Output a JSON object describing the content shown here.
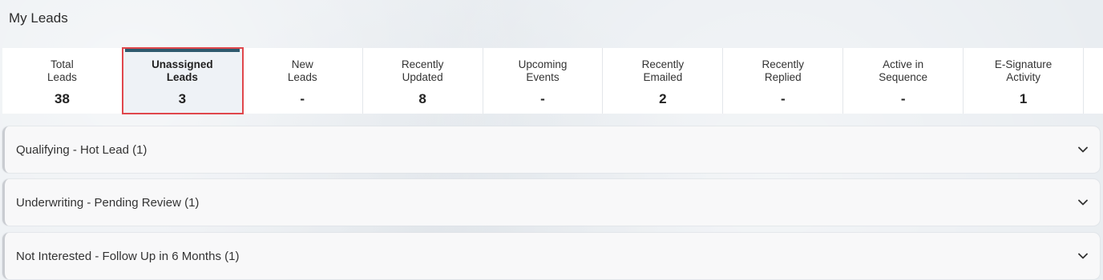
{
  "header": {
    "title": "My Leads"
  },
  "stats": [
    {
      "label": "Total\nLeads",
      "value": "38"
    },
    {
      "label": "Unassigned\nLeads",
      "value": "3"
    },
    {
      "label": "New\nLeads",
      "value": "-"
    },
    {
      "label": "Recently\nUpdated",
      "value": "8"
    },
    {
      "label": "Upcoming\nEvents",
      "value": "-"
    },
    {
      "label": "Recently\nEmailed",
      "value": "2"
    },
    {
      "label": "Recently\nReplied",
      "value": "-"
    },
    {
      "label": "Active in\nSequence",
      "value": "-"
    },
    {
      "label": "E-Signature\nActivity",
      "value": "1"
    }
  ],
  "active_stat": "Unassigned Leads",
  "groups": [
    {
      "title": "Qualifying - Hot Lead (1)"
    },
    {
      "title": "Underwriting - Pending Review (1)"
    },
    {
      "title": "Not Interested - Follow Up in 6 Months (1)"
    }
  ],
  "colors": {
    "accent": "#2e5a6e",
    "highlight": "#e0474c"
  }
}
